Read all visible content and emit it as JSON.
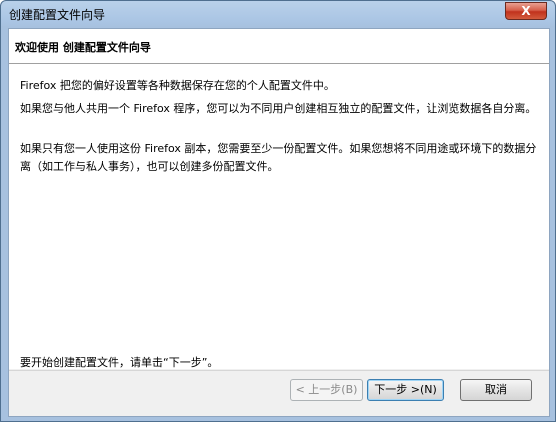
{
  "window": {
    "title": "创建配置文件向导",
    "close_glyph": "X"
  },
  "header": {
    "title": "欢迎使用 创建配置文件向导"
  },
  "content": {
    "paragraphs": [
      "Firefox 把您的偏好设置等各种数据保存在您的个人配置文件中。",
      "如果您与他人共用一个 Firefox 程序，您可以为不同用户创建相互独立的配置文件，让浏览数据各自分离。",
      "如果只有您一人使用这份 Firefox 副本，您需要至少一份配置文件。如果您想将不同用途或环境下的数据分离（如工作与私人事务），也可以创建多份配置文件。",
      "要开始创建配置文件，请单击“下一步”。"
    ]
  },
  "buttons": {
    "back_label": "< 上一步(B)",
    "next_label": "下一步 >(N)",
    "cancel_label": "取消"
  }
}
